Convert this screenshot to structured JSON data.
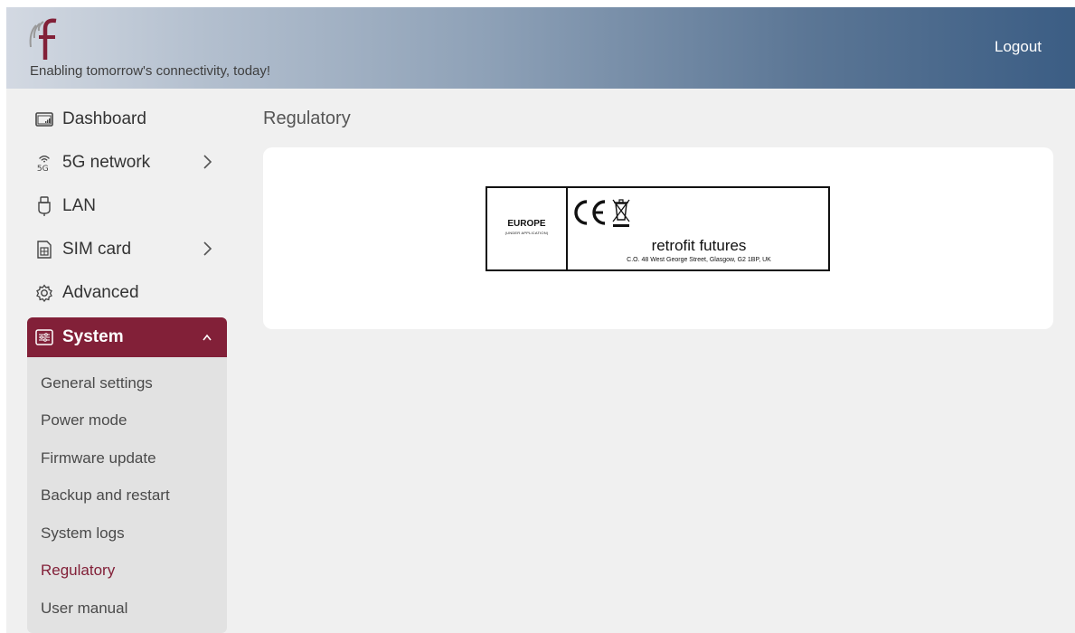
{
  "header": {
    "tagline": "Enabling tomorrow's connectivity, today!",
    "logout_label": "Logout",
    "brand_color": "#822038",
    "logo_icon": "rf-logo-icon"
  },
  "sidebar": {
    "items": [
      {
        "label": "Dashboard",
        "icon": "dashboard-icon"
      },
      {
        "label": "5G network",
        "icon": "5g-icon",
        "expandable": true
      },
      {
        "label": "LAN",
        "icon": "lan-icon"
      },
      {
        "label": "SIM card",
        "icon": "sim-card-icon",
        "expandable": true
      },
      {
        "label": "Advanced",
        "icon": "gear-icon"
      },
      {
        "label": "System",
        "icon": "system-icon",
        "expanded": true,
        "active": true
      }
    ],
    "system_subitems": [
      {
        "label": "General settings"
      },
      {
        "label": "Power mode"
      },
      {
        "label": "Firmware update"
      },
      {
        "label": "Backup and restart"
      },
      {
        "label": "System logs"
      },
      {
        "label": "Regulatory",
        "current": true
      },
      {
        "label": "User manual"
      }
    ]
  },
  "main": {
    "title": "Regulatory",
    "regulatory_label": {
      "region": "EUROPE",
      "region_note": "(UNDER APPLICATION)",
      "mark": "CE",
      "brand": "retrofit futures",
      "address": "C.O. 48 West George Street, Glasgow, G2 1BP, UK"
    }
  }
}
